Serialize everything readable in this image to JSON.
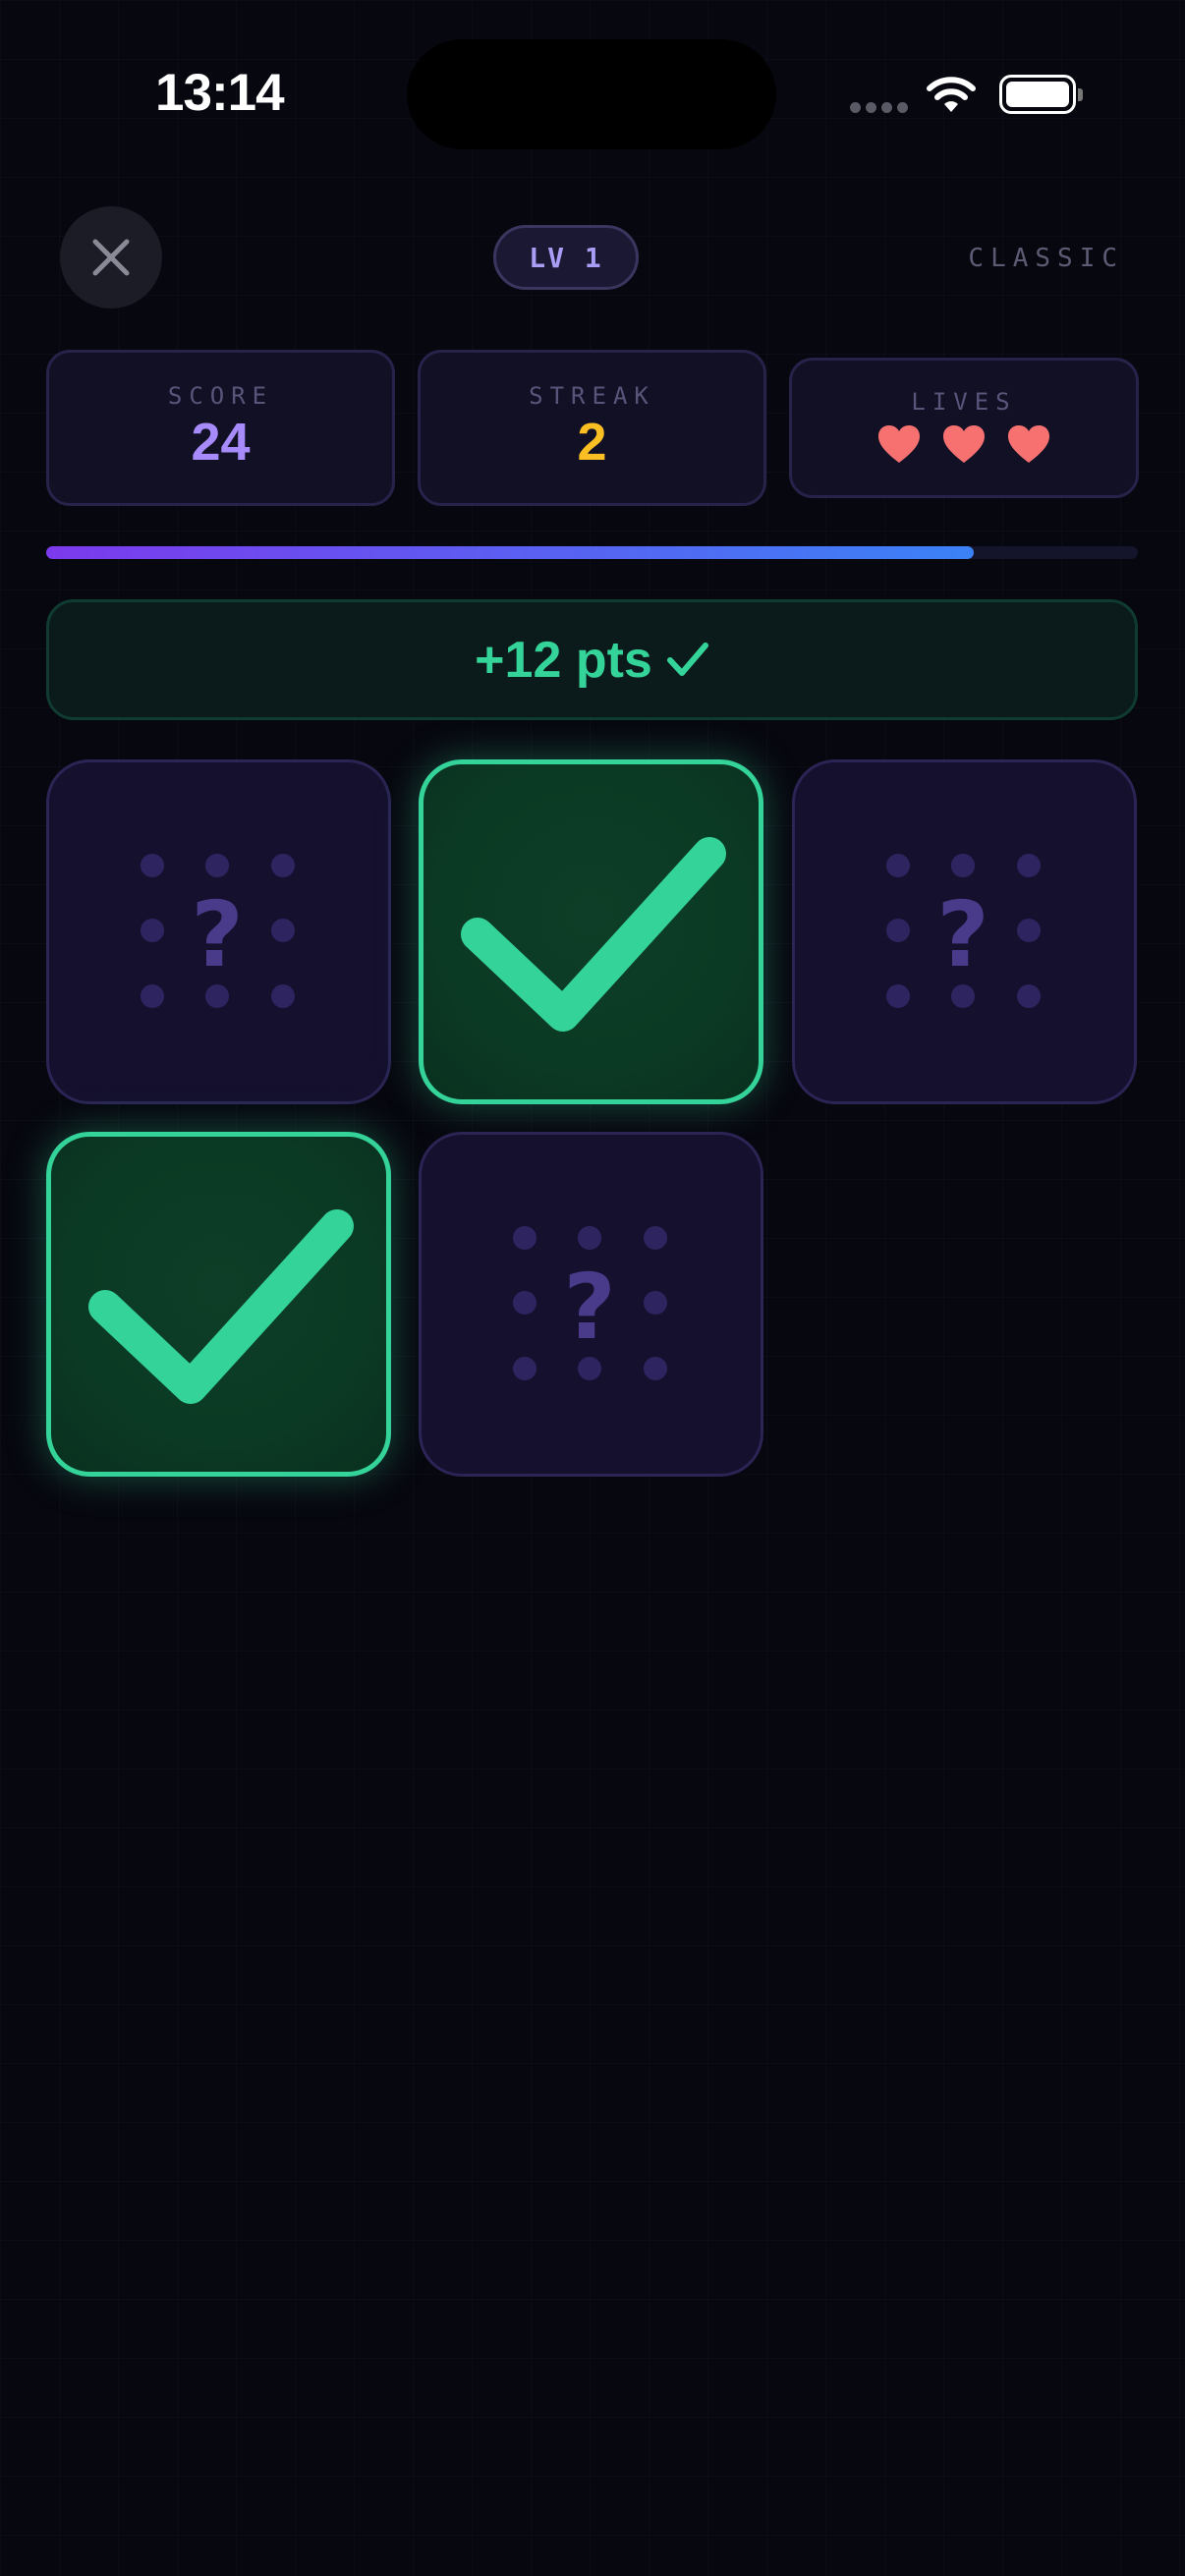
{
  "status_bar": {
    "time": "13:14"
  },
  "header": {
    "close_icon": "close-icon",
    "level_label": "LV 1",
    "mode_label": "CLASSIC"
  },
  "stats": {
    "score": {
      "label": "SCORE",
      "value": "24",
      "color": "#a78bfa"
    },
    "streak": {
      "label": "STREAK",
      "value": "2",
      "color": "#fbbf24"
    },
    "lives": {
      "label": "LIVES",
      "count": 3,
      "icon": "heart-icon",
      "color": "#f87171"
    }
  },
  "progress": {
    "fraction": 0.85,
    "gradient": [
      "#7c3aed",
      "#3b82f6"
    ]
  },
  "feedback": {
    "text": "+12 pts",
    "icon": "checkmark-icon",
    "color": "#34d399"
  },
  "tiles": [
    {
      "state": "hidden",
      "icon": "question-icon"
    },
    {
      "state": "matched",
      "icon": "checkmark-icon"
    },
    {
      "state": "hidden",
      "icon": "question-icon"
    },
    {
      "state": "matched",
      "icon": "checkmark-icon"
    },
    {
      "state": "hidden",
      "icon": "question-icon"
    }
  ]
}
